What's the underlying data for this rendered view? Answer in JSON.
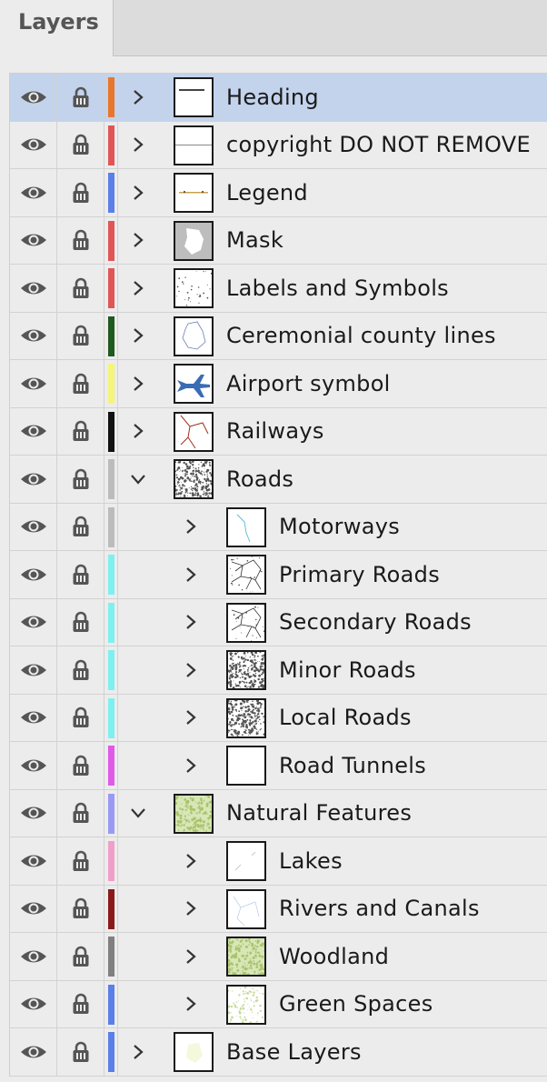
{
  "panel": {
    "tab_label": "Layers"
  },
  "layers": [
    {
      "name": "Heading",
      "color": "#e8772c",
      "depth": 0,
      "expanded": false,
      "selected": true,
      "thumb": "heading"
    },
    {
      "name": "copyright DO NOT REMOVE",
      "color": "#e05656",
      "depth": 0,
      "expanded": false,
      "thumb": "line"
    },
    {
      "name": "Legend",
      "color": "#5b7fe8",
      "depth": 0,
      "expanded": false,
      "thumb": "legend"
    },
    {
      "name": "Mask",
      "color": "#e05656",
      "depth": 0,
      "expanded": false,
      "thumb": "mask"
    },
    {
      "name": "Labels and Symbols",
      "color": "#e05656",
      "depth": 0,
      "expanded": false,
      "thumb": "dots"
    },
    {
      "name": "Ceremonial county lines",
      "color": "#1f5a1f",
      "depth": 0,
      "expanded": false,
      "thumb": "outline"
    },
    {
      "name": "Airport symbol",
      "color": "#f5f57a",
      "depth": 0,
      "expanded": false,
      "thumb": "plane"
    },
    {
      "name": "Railways",
      "color": "#111111",
      "depth": 0,
      "expanded": false,
      "thumb": "rail"
    },
    {
      "name": "Roads",
      "color": "#bcbcbc",
      "depth": 0,
      "expanded": true,
      "thumb": "densegray"
    },
    {
      "name": "Motorways",
      "color": "#bcbcbc",
      "depth": 1,
      "expanded": false,
      "thumb": "motorway"
    },
    {
      "name": "Primary Roads",
      "color": "#7ff0f0",
      "depth": 1,
      "expanded": false,
      "thumb": "network"
    },
    {
      "name": "Secondary Roads",
      "color": "#7ff0f0",
      "depth": 1,
      "expanded": false,
      "thumb": "network"
    },
    {
      "name": "Minor Roads",
      "color": "#7ff0f0",
      "depth": 1,
      "expanded": false,
      "thumb": "densegray"
    },
    {
      "name": "Local Roads",
      "color": "#7ff0f0",
      "depth": 1,
      "expanded": false,
      "thumb": "densegray"
    },
    {
      "name": "Road Tunnels",
      "color": "#e05ae8",
      "depth": 1,
      "expanded": false,
      "thumb": "blank"
    },
    {
      "name": "Natural Features",
      "color": "#9a9af5",
      "depth": 0,
      "expanded": true,
      "thumb": "green"
    },
    {
      "name": "Lakes",
      "color": "#f0a0c8",
      "depth": 1,
      "expanded": false,
      "thumb": "lakes"
    },
    {
      "name": "Rivers and Canals",
      "color": "#8a1a1a",
      "depth": 1,
      "expanded": false,
      "thumb": "rivers"
    },
    {
      "name": "Woodland",
      "color": "#808080",
      "depth": 1,
      "expanded": false,
      "thumb": "green"
    },
    {
      "name": "Green Spaces",
      "color": "#5b7fe8",
      "depth": 1,
      "expanded": false,
      "thumb": "lightgreen"
    },
    {
      "name": "Base Layers",
      "color": "#5b7fe8",
      "depth": 0,
      "expanded": false,
      "thumb": "pale"
    }
  ]
}
